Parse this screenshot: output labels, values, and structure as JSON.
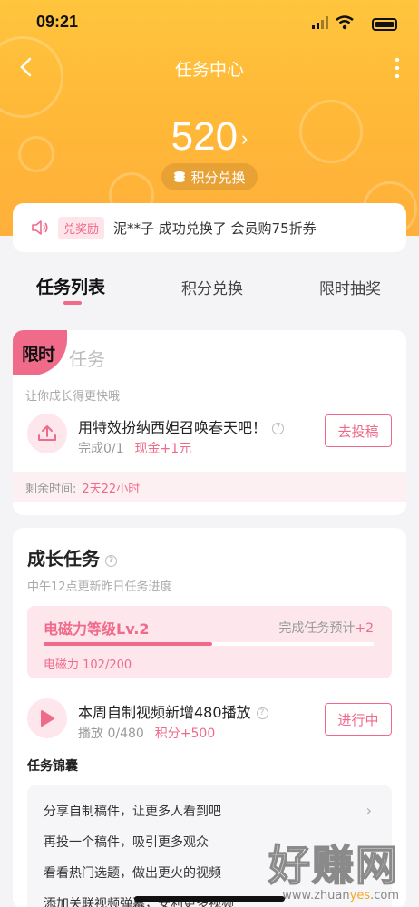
{
  "status": {
    "time": "09:21"
  },
  "nav": {
    "title": "任务中心"
  },
  "hero": {
    "points": "520",
    "exchange_label": "积分兑换"
  },
  "notice": {
    "tag": "兑奖励",
    "text": "泥**子 成功兑换了 会员购75折券"
  },
  "tabs": [
    {
      "label": "任务列表",
      "active": true
    },
    {
      "label": "积分兑换",
      "active": false
    },
    {
      "label": "限时抽奖",
      "active": false
    }
  ],
  "limited": {
    "badge": "限时",
    "title": "任务",
    "subtitle": "让你成长得更快哦",
    "task": {
      "title": "用特效扮纳西妲召唤春天吧！",
      "progress": "完成0/1",
      "reward": "现金+1元",
      "button": "去投稿"
    },
    "remain_label": "剩余时间:",
    "remain_value": "2天22小时"
  },
  "growth": {
    "title": "成长任务",
    "subtitle": "中午12点更新昨日任务进度",
    "level": {
      "name": "电磁力等级Lv.2",
      "tip_prefix": "完成任务预计",
      "tip_plus": "+2",
      "value_text": "电磁力 102/200",
      "progress": 0.51
    },
    "task": {
      "title": "本周自制视频新增480播放",
      "progress": "播放 0/480",
      "reward": "积分+500",
      "button": "进行中"
    },
    "kit_label": "任务锦囊",
    "kit_items": [
      "分享自制稿件，让更多人看到吧",
      "再投一个稿件，吸引更多观众",
      "看看热门选题，做出更火的视频",
      "添加关联视频弹幕，安利更多视频"
    ]
  },
  "watermark": {
    "big": "好赚网",
    "small_prefix": "www.zhuan",
    "small_accent": "yes",
    "small_suffix": ".com"
  },
  "colors": {
    "accent": "#f06a8a",
    "hero": "#ffb938"
  }
}
